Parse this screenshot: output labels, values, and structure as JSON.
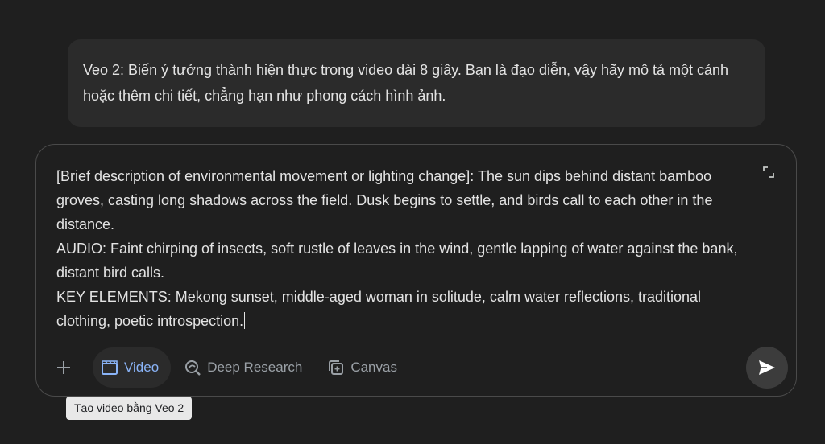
{
  "info_card": {
    "text": "Veo 2: Biến ý tưởng thành hiện thực trong video dài 8 giây. Bạn là đạo diễn, vậy hãy mô tả một cảnh hoặc thêm chi tiết, chẳng hạn như phong cách hình ảnh."
  },
  "composer": {
    "prompt_lines": [
      "[Brief description of environmental movement or lighting change]: The sun dips behind distant bamboo groves, casting long shadows across the field. Dusk begins to settle, and birds call to each other in the distance.",
      "AUDIO: Faint chirping of insects, soft rustle of leaves in the wind, gentle lapping of water against the bank, distant bird calls.",
      "KEY ELEMENTS: Mekong sunset, middle-aged woman in solitude, calm water reflections, traditional clothing, poetic introspection."
    ],
    "tools": [
      {
        "label": "Video",
        "icon": "clapperboard-icon",
        "active": true
      },
      {
        "label": "Deep Research",
        "icon": "deep-research-icon",
        "active": false
      },
      {
        "label": "Canvas",
        "icon": "canvas-icon",
        "active": false
      }
    ],
    "plus_icon": "plus-icon",
    "expand_icon": "expand-icon",
    "send_icon": "send-icon"
  },
  "tooltip": {
    "text": "Tạo video bằng Veo 2"
  },
  "colors": {
    "background": "#1f1f1f",
    "card": "#2b2b2b",
    "accent": "#8ab4f8",
    "text": "#e3e3e3",
    "muted": "#9aa0a6"
  }
}
